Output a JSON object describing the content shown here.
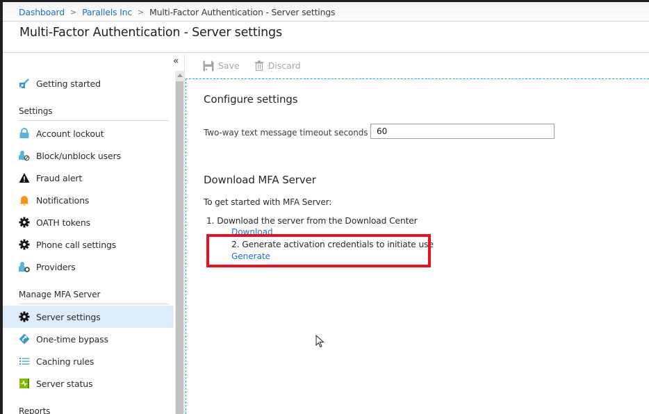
{
  "breadcrumb": {
    "items": [
      {
        "label": "Dashboard",
        "link": true
      },
      {
        "label": "Parallels Inc",
        "link": true
      },
      {
        "label": "Multi-Factor Authentication - Server settings",
        "link": false
      }
    ],
    "separator": ">"
  },
  "header": {
    "title": "Multi-Factor Authentication - Server settings"
  },
  "sidebar": {
    "collapse_icon": "double-chevron-left-icon",
    "collapse_glyph": "«",
    "getting_started": {
      "label": "Getting started",
      "icon": "rocket-icon"
    },
    "sections": [
      {
        "label": "Settings",
        "items": [
          {
            "label": "Account lockout",
            "icon": "lock-icon"
          },
          {
            "label": "Block/unblock users",
            "icon": "user-block-icon"
          },
          {
            "label": "Fraud alert",
            "icon": "warning-icon"
          },
          {
            "label": "Notifications",
            "icon": "bell-icon"
          },
          {
            "label": "OATH tokens",
            "icon": "gear-icon"
          },
          {
            "label": "Phone call settings",
            "icon": "gear-icon"
          },
          {
            "label": "Providers",
            "icon": "user-settings-icon"
          }
        ]
      },
      {
        "label": "Manage MFA Server",
        "items": [
          {
            "label": "Server settings",
            "icon": "gear-icon",
            "active": true
          },
          {
            "label": "One-time bypass",
            "icon": "bypass-diamond-icon"
          },
          {
            "label": "Caching rules",
            "icon": "list-icon"
          },
          {
            "label": "Server status",
            "icon": "pulse-icon"
          }
        ]
      },
      {
        "label": "Reports",
        "items": []
      }
    ]
  },
  "toolbar": {
    "save_label": "Save",
    "discard_label": "Discard",
    "save_icon": "save-icon",
    "discard_icon": "trash-icon"
  },
  "configure": {
    "heading": "Configure settings",
    "timeout_label": "Two-way text message timeout seconds",
    "timeout_value": "60"
  },
  "download": {
    "heading": "Download MFA Server",
    "intro": "To get started with MFA Server:",
    "steps": [
      {
        "text": "1. Download the server from the Download Center",
        "link": "Download"
      },
      {
        "text": "2. Generate activation credentials to initiate use",
        "link": "Generate"
      }
    ]
  },
  "annotation": {
    "highlight_color": "#e81123",
    "highlight_target": "step-2"
  },
  "colors": {
    "link": "#1f6fc5",
    "active_nav_bg": "#dcecfb",
    "panel_border": "#1aa1d8",
    "disabled_text": "#a6a6a6"
  }
}
